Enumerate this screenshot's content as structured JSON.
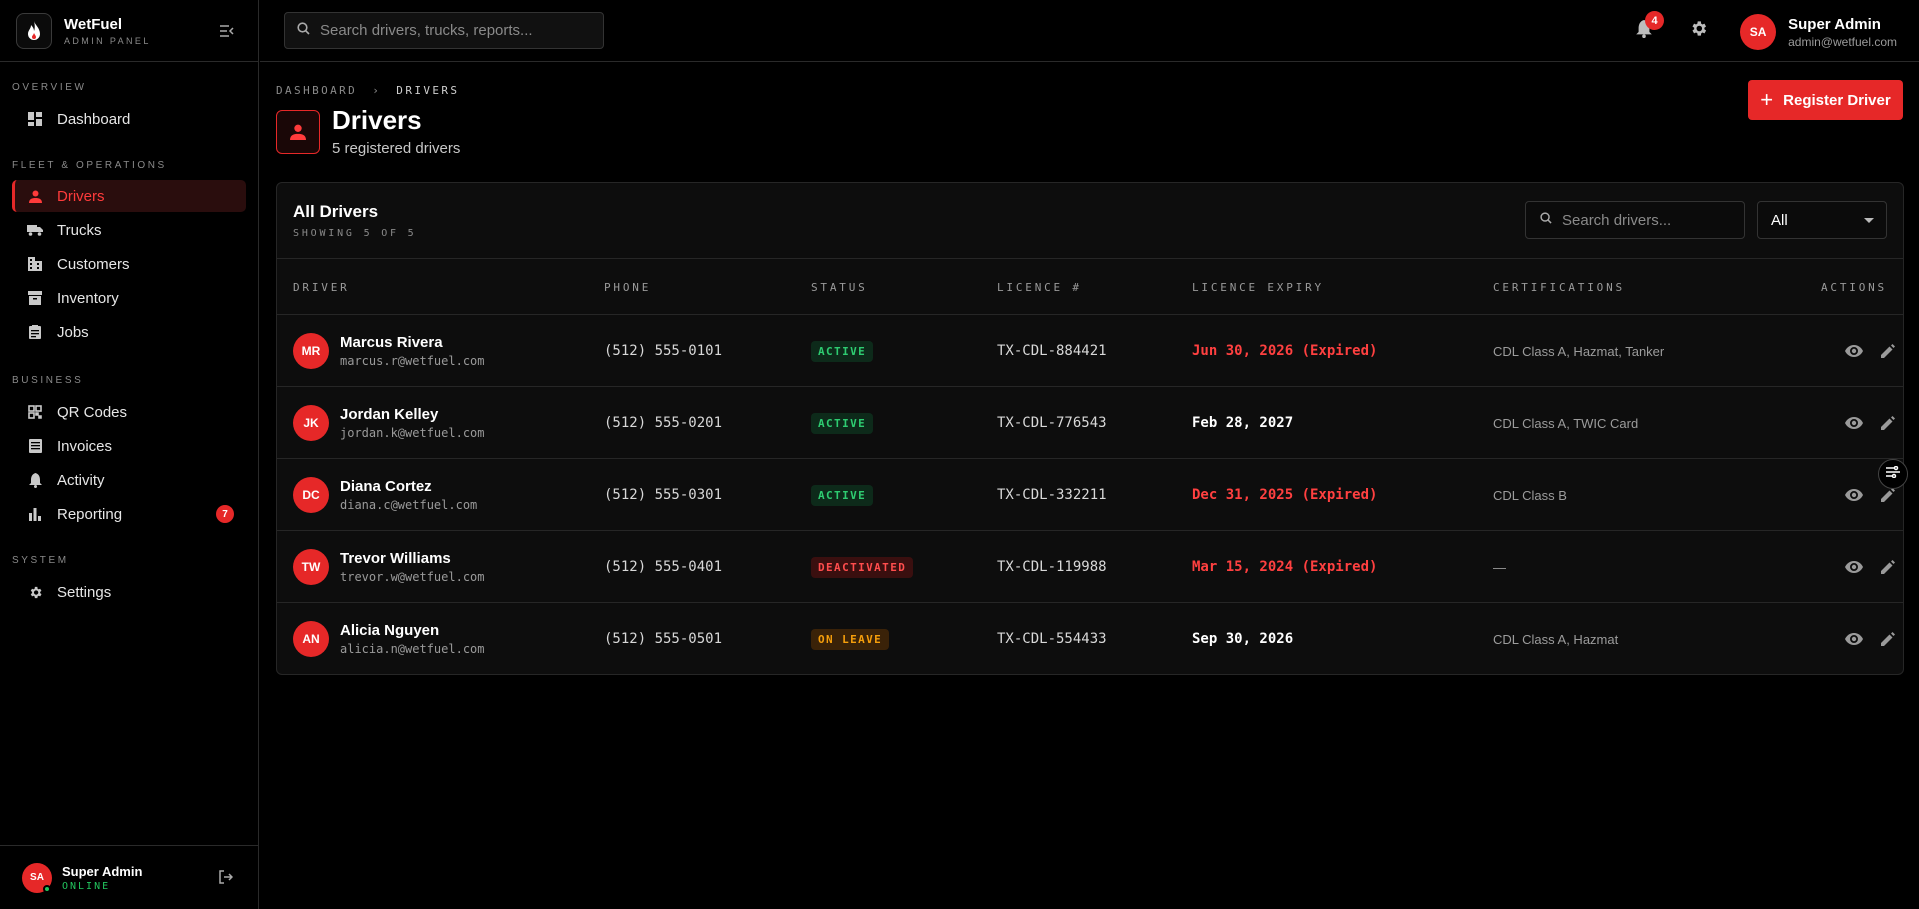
{
  "brand": {
    "name": "WetFuel",
    "sub": "ADMIN PANEL"
  },
  "sidebar": {
    "sections": [
      {
        "title": "OVERVIEW"
      },
      {
        "title": "FLEET & OPERATIONS"
      },
      {
        "title": "BUSINESS"
      },
      {
        "title": "SYSTEM"
      }
    ],
    "items": [
      {
        "label": "Dashboard",
        "icon": "dashboard-icon"
      },
      {
        "label": "Drivers",
        "icon": "person-icon",
        "active": true
      },
      {
        "label": "Trucks",
        "icon": "truck-icon"
      },
      {
        "label": "Customers",
        "icon": "building-icon"
      },
      {
        "label": "Inventory",
        "icon": "archive-icon"
      },
      {
        "label": "Jobs",
        "icon": "clipboard-icon"
      },
      {
        "label": "QR Codes",
        "icon": "qr-code-icon"
      },
      {
        "label": "Invoices",
        "icon": "receipt-icon"
      },
      {
        "label": "Activity",
        "icon": "bell-icon"
      },
      {
        "label": "Reporting",
        "icon": "bar-chart-icon",
        "badge": "7"
      },
      {
        "label": "Settings",
        "icon": "gear-icon"
      }
    ],
    "footer": {
      "initials": "SA",
      "name": "Super Admin",
      "status": "ONLINE"
    }
  },
  "topbar": {
    "search_placeholder": "Search drivers, trucks, reports...",
    "notification_count": "4",
    "user": {
      "initials": "SA",
      "name": "Super Admin",
      "email": "admin@wetfuel.com"
    }
  },
  "breadcrumb": {
    "root": "DASHBOARD",
    "separator": "›",
    "current": "DRIVERS"
  },
  "page": {
    "title": "Drivers",
    "subtitle": "5 registered drivers",
    "register_label": "Register Driver"
  },
  "card": {
    "title": "All Drivers",
    "subtitle": "SHOWING 5 OF 5",
    "search_placeholder": "Search drivers...",
    "filter_value": "All"
  },
  "table": {
    "columns": [
      "DRIVER",
      "PHONE",
      "STATUS",
      "LICENCE #",
      "LICENCE EXPIRY",
      "CERTIFICATIONS",
      "ACTIONS"
    ],
    "rows": [
      {
        "initials": "MR",
        "name": "Marcus Rivera",
        "email": "marcus.r@wetfuel.com",
        "phone": "(512) 555-0101",
        "status": "ACTIVE",
        "status_kind": "active",
        "licence": "TX-CDL-884421",
        "expiry": "Jun 30, 2026 (Expired)",
        "expired": true,
        "certs": "CDL Class A, Hazmat, Tanker"
      },
      {
        "initials": "JK",
        "name": "Jordan Kelley",
        "email": "jordan.k@wetfuel.com",
        "phone": "(512) 555-0201",
        "status": "ACTIVE",
        "status_kind": "active",
        "licence": "TX-CDL-776543",
        "expiry": "Feb 28, 2027",
        "expired": false,
        "certs": "CDL Class A, TWIC Card"
      },
      {
        "initials": "DC",
        "name": "Diana Cortez",
        "email": "diana.c@wetfuel.com",
        "phone": "(512) 555-0301",
        "status": "ACTIVE",
        "status_kind": "active",
        "licence": "TX-CDL-332211",
        "expiry": "Dec 31, 2025 (Expired)",
        "expired": true,
        "certs": "CDL Class B"
      },
      {
        "initials": "TW",
        "name": "Trevor Williams",
        "email": "trevor.w@wetfuel.com",
        "phone": "(512) 555-0401",
        "status": "DEACTIVATED",
        "status_kind": "deactivated",
        "licence": "TX-CDL-119988",
        "expiry": "Mar 15, 2024 (Expired)",
        "expired": true,
        "certs": "—"
      },
      {
        "initials": "AN",
        "name": "Alicia Nguyen",
        "email": "alicia.n@wetfuel.com",
        "phone": "(512) 555-0501",
        "status": "ON LEAVE",
        "status_kind": "leave",
        "licence": "TX-CDL-554433",
        "expiry": "Sep 30, 2026",
        "expired": false,
        "certs": "CDL Class A, Hazmat"
      }
    ]
  },
  "colors": {
    "accent": "#e62828",
    "active": "#2ecc71",
    "leave": "#f59e0b",
    "expired": "#ff4040"
  }
}
